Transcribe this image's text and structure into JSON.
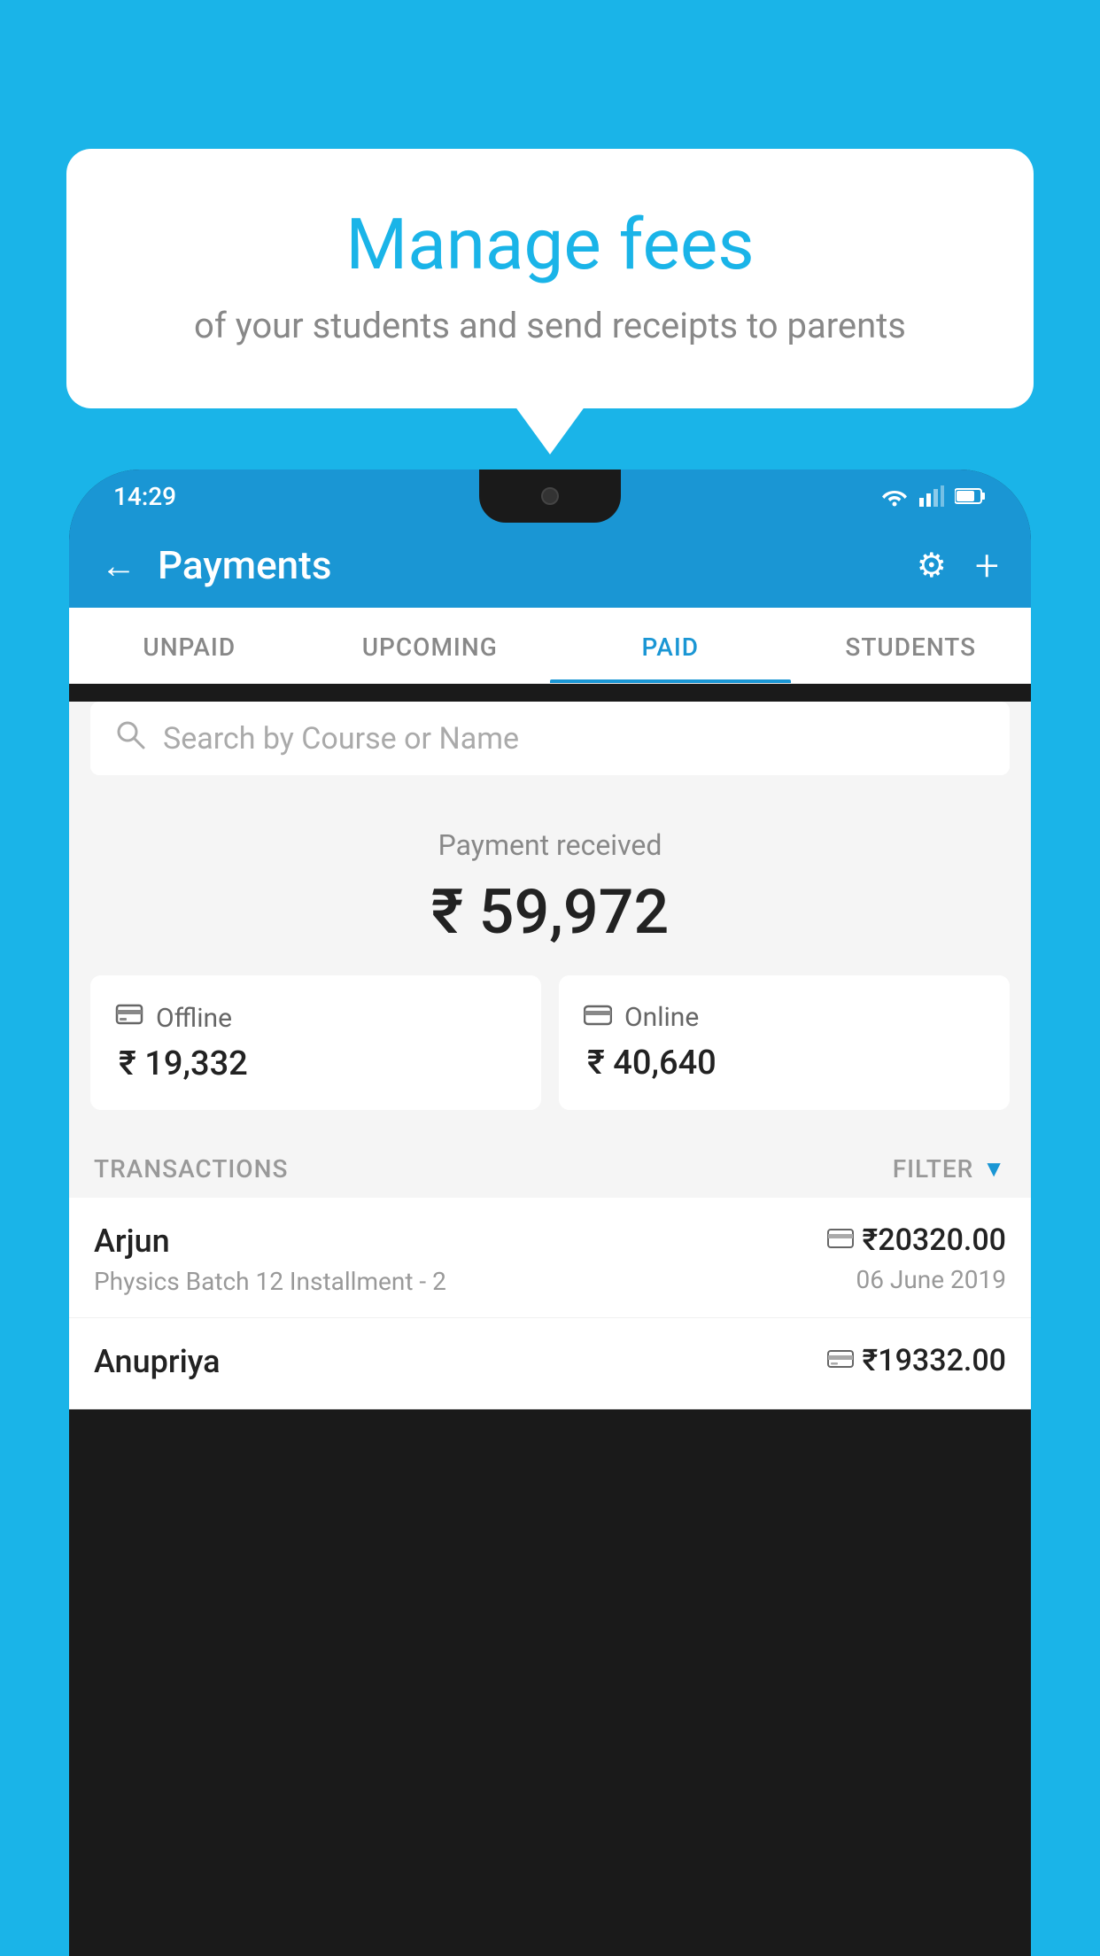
{
  "page": {
    "background_color": "#1ab4e8"
  },
  "speech_bubble": {
    "title": "Manage fees",
    "subtitle": "of your students and send receipts to parents"
  },
  "status_bar": {
    "time": "14:29"
  },
  "app_header": {
    "title": "Payments",
    "back_label": "←",
    "settings_icon": "⚙",
    "add_icon": "+"
  },
  "tabs": [
    {
      "label": "UNPAID",
      "active": false
    },
    {
      "label": "UPCOMING",
      "active": false
    },
    {
      "label": "PAID",
      "active": true
    },
    {
      "label": "STUDENTS",
      "active": false
    }
  ],
  "search": {
    "placeholder": "Search by Course or Name"
  },
  "payment_summary": {
    "label": "Payment received",
    "amount": "₹ 59,972"
  },
  "payment_cards": [
    {
      "label": "Offline",
      "amount": "₹ 19,332",
      "icon": "₹"
    },
    {
      "label": "Online",
      "amount": "₹ 40,640",
      "icon": "💳"
    }
  ],
  "transactions_section": {
    "label": "TRANSACTIONS",
    "filter_label": "FILTER"
  },
  "transactions": [
    {
      "name": "Arjun",
      "sub": "Physics Batch 12 Installment - 2",
      "amount": "₹20320.00",
      "date": "06 June 2019",
      "type": "online"
    },
    {
      "name": "Anupriya",
      "sub": "",
      "amount": "₹19332.00",
      "date": "",
      "type": "offline"
    }
  ]
}
